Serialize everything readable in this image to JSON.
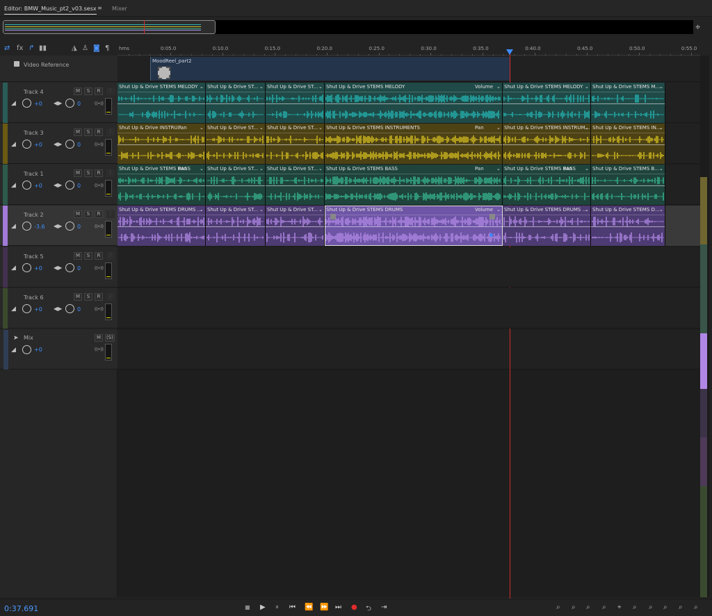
{
  "tabs": {
    "editor": "Editor: BMW_Music_pt2_v03.sesx",
    "menu": "≡",
    "mixer": "Mixer"
  },
  "tools": [
    {
      "name": "loop-icon",
      "glyph": "⇄"
    },
    {
      "name": "fx-icon",
      "glyph": "fx"
    },
    {
      "name": "send-icon",
      "glyph": "↱"
    },
    {
      "name": "eq-icon",
      "glyph": "▮▮"
    },
    {
      "name": "metronome-icon",
      "glyph": "◮"
    },
    {
      "name": "person-icon",
      "glyph": "♙"
    },
    {
      "name": "headphones-icon",
      "glyph": "◙"
    },
    {
      "name": "pin-icon",
      "glyph": "¶"
    }
  ],
  "ruler": {
    "unit": "hms",
    "ticks": [
      "0:05.0",
      "0:10.0",
      "0:15.0",
      "0:20.0",
      "0:25.0",
      "0:30.0",
      "0:35.0",
      "0:40.0",
      "0:45.0",
      "0:50.0",
      "0:55.0"
    ]
  },
  "video": {
    "label": "Video Reference",
    "clip": "MoodReel_part2"
  },
  "tracks": [
    {
      "id": "t4",
      "name": "Track 4",
      "color": "#2a5c57",
      "vol": "+0",
      "pan": "0",
      "clipColor": "#1f4a47",
      "waveColor": "#25b7b5",
      "clips": [
        {
          "name": "Shut Up & Drive STEMS MELODY",
          "param": ""
        },
        {
          "name": "Shut Up & Drive ST...",
          "param": ""
        },
        {
          "name": "Shut Up & Drive ST...",
          "param": ""
        },
        {
          "name": "Shut Up & Drive STEMS MELODY",
          "param": "Volume"
        },
        {
          "name": "Shut Up & Drive STEMS MELODY",
          "param": ""
        },
        {
          "name": "Shut Up & Drive STEMS M...",
          "param": ""
        }
      ]
    },
    {
      "id": "t3",
      "name": "Track 3",
      "color": "#6a5a12",
      "vol": "+0",
      "pan": "0",
      "clipColor": "#4d4214",
      "waveColor": "#d7c021",
      "clips": [
        {
          "name": "Shut Up & Drive INSTRU...",
          "param": "Pan"
        },
        {
          "name": "Shut Up & Drive ST...",
          "param": ""
        },
        {
          "name": "Shut Up & Drive ST...",
          "param": ""
        },
        {
          "name": "Shut Up & Drive STEMS INSTRUMENTS",
          "param": "Pan"
        },
        {
          "name": "Shut Up & Drive STEMS INSTRUM...",
          "param": ""
        },
        {
          "name": "Shut Up & Drive STEMS IN...",
          "param": ""
        }
      ]
    },
    {
      "id": "t1",
      "name": "Track 1",
      "color": "#2e5a4c",
      "vol": "+0",
      "pan": "0",
      "clipColor": "#1e443c",
      "waveColor": "#37b88f",
      "clips": [
        {
          "name": "Shut Up & Drive STEMS BASS",
          "param": "Pan"
        },
        {
          "name": "Shut Up & Drive ST...",
          "param": ""
        },
        {
          "name": "Shut Up & Drive ST...",
          "param": ""
        },
        {
          "name": "Shut Up & Drive STEMS BASS",
          "param": "Pan"
        },
        {
          "name": "Shut Up & Drive STEMS BASS",
          "param": "Pan"
        },
        {
          "name": "Shut Up & Drive STEMS B...",
          "param": ""
        }
      ]
    },
    {
      "id": "t2",
      "name": "Track 2",
      "color": "#a27ad8",
      "vol": "-3.6",
      "pan": "0",
      "clipColor": "#4d3b73",
      "waveColor": "#b38be8",
      "clips": [
        {
          "name": "Shut Up & Drive STEMS DRUMS ...",
          "param": ""
        },
        {
          "name": "Shut Up & Drive ST...",
          "param": ""
        },
        {
          "name": "Shut Up & Drive ST...",
          "param": ""
        },
        {
          "name": "Shut Up & Drive STEMS DRUMS",
          "param": "Volume"
        },
        {
          "name": "Shut Up & Drive STEMS DRUMS ...",
          "param": ""
        },
        {
          "name": "Shut Up & Drive STEMS D...",
          "param": ""
        }
      ]
    },
    {
      "id": "t5",
      "name": "Track 5",
      "color": "#43304f",
      "vol": "+0",
      "pan": "0",
      "clips": []
    },
    {
      "id": "t6",
      "name": "Track 6",
      "color": "#3b4a2c",
      "vol": "+0",
      "pan": "0",
      "clips": []
    }
  ],
  "mix": {
    "name": "Mix",
    "vol": "+0",
    "m": "M",
    "s": "(S)"
  },
  "buttons": {
    "m": "M",
    "s": "S",
    "r": "R",
    "more": "⋮",
    "input": "((•))"
  },
  "transport": {
    "time": "0:37.691",
    "stop": "■",
    "play": "▶",
    "pause": "⏸",
    "start": "⏮",
    "rew": "⏪",
    "ffw": "⏩",
    "end": "⏭",
    "record": "●",
    "loop": "⮌",
    "skip": "⇥"
  },
  "zoom": [
    "Q",
    "Q",
    "Q",
    "Q",
    "Q",
    "Q",
    "Q",
    "Q",
    "Q",
    "Q",
    "Q"
  ]
}
